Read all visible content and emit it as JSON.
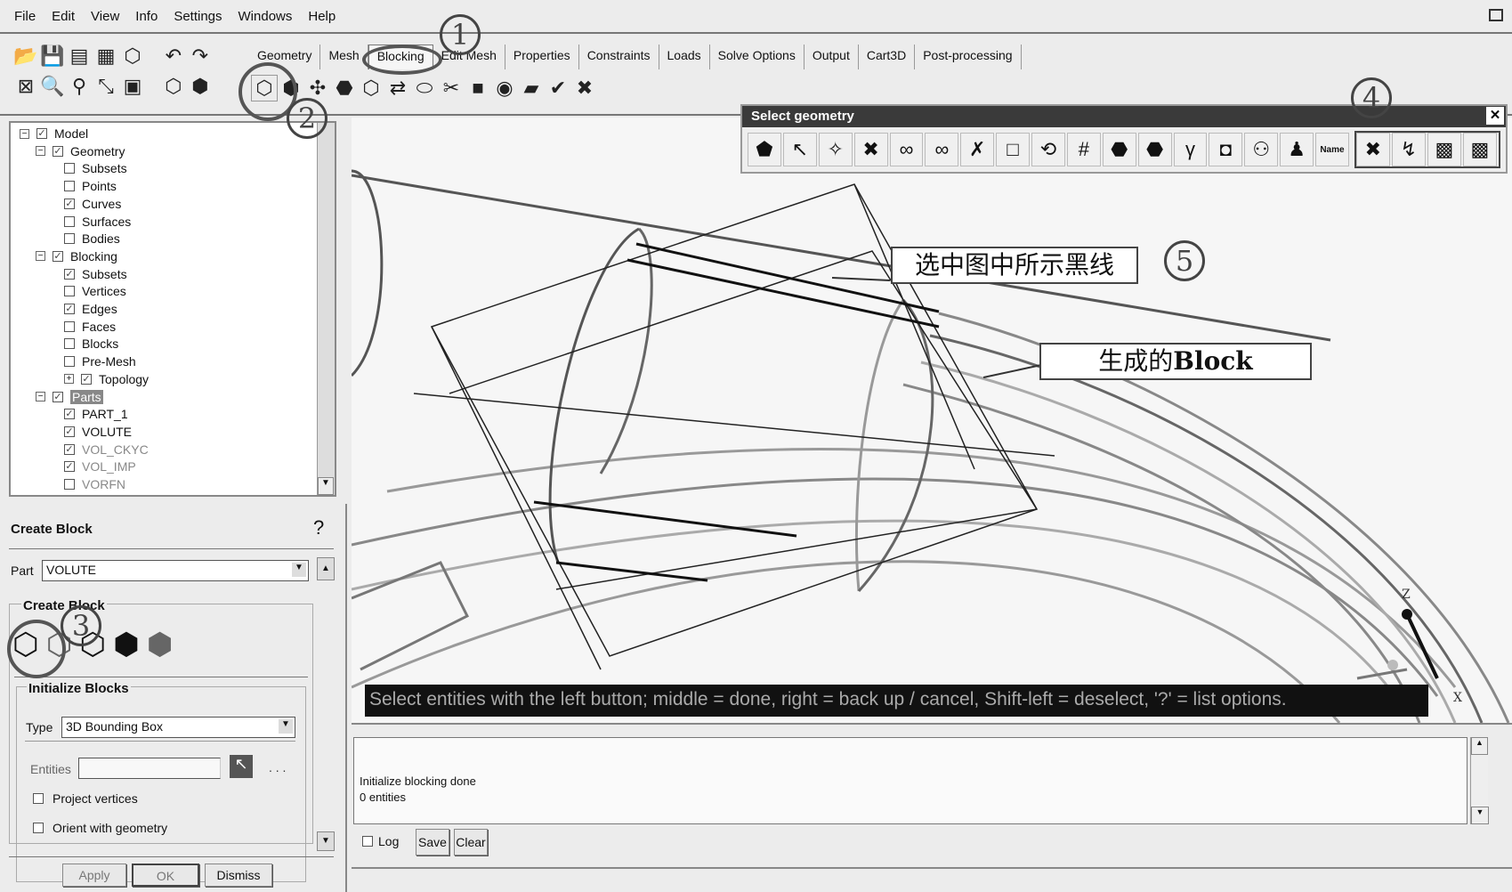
{
  "menu": [
    "File",
    "Edit",
    "View",
    "Info",
    "Settings",
    "Windows",
    "Help"
  ],
  "tabs": [
    "Geometry",
    "Mesh",
    "Blocking",
    "Edit Mesh",
    "Properties",
    "Constraints",
    "Loads",
    "Solve Options",
    "Output",
    "Cart3D",
    "Post-processing"
  ],
  "active_tab": "Blocking",
  "tree": [
    {
      "label": "Model",
      "level": 0,
      "checked": true,
      "exp": "-"
    },
    {
      "label": "Geometry",
      "level": 1,
      "checked": true,
      "exp": "-"
    },
    {
      "label": "Subsets",
      "level": 2,
      "checked": false
    },
    {
      "label": "Points",
      "level": 2,
      "checked": false
    },
    {
      "label": "Curves",
      "level": 2,
      "checked": true
    },
    {
      "label": "Surfaces",
      "level": 2,
      "checked": false
    },
    {
      "label": "Bodies",
      "level": 2,
      "checked": false
    },
    {
      "label": "Blocking",
      "level": 1,
      "checked": true,
      "exp": "-"
    },
    {
      "label": "Subsets",
      "level": 2,
      "checked": true
    },
    {
      "label": "Vertices",
      "level": 2,
      "checked": false
    },
    {
      "label": "Edges",
      "level": 2,
      "checked": true
    },
    {
      "label": "Faces",
      "level": 2,
      "checked": false
    },
    {
      "label": "Blocks",
      "level": 2,
      "checked": false
    },
    {
      "label": "Pre-Mesh",
      "level": 2,
      "checked": false
    },
    {
      "label": "Topology",
      "level": 2,
      "checked": true,
      "exp": "+"
    },
    {
      "label": "Parts",
      "level": 1,
      "checked": true,
      "exp": "-",
      "highlight": true
    },
    {
      "label": "PART_1",
      "level": 2,
      "checked": true
    },
    {
      "label": "VOLUTE",
      "level": 2,
      "checked": true
    },
    {
      "label": "VOL_CKYC",
      "level": 2,
      "checked": true,
      "dim": true
    },
    {
      "label": "VOL_IMP",
      "level": 2,
      "checked": true,
      "dim": true
    },
    {
      "label": "VORFN",
      "level": 2,
      "checked": false,
      "dim": true
    }
  ],
  "create_block": {
    "title": "Create Block",
    "part_label": "Part",
    "part_value": "VOLUTE",
    "group_label": "Create Block",
    "init_label": "Initialize Blocks",
    "type_label": "Type",
    "type_value": "3D Bounding Box",
    "entities_label": "Entities",
    "entities_value": "",
    "more": ". . .",
    "project_vertices": "Project vertices",
    "orient": "Orient with geometry",
    "apply": "Apply",
    "ok": "OK",
    "dismiss": "Dismiss"
  },
  "select_geometry": {
    "title": "Select geometry",
    "name_icon": "Name"
  },
  "status_prompt": "Select entities with the left button; middle = done, right = back up / cancel, Shift-left = deselect, '?' = list options.",
  "messages": [
    "Initialize blocking done",
    "0 entities"
  ],
  "log": {
    "log": "Log",
    "save": "Save",
    "clear": "Clear"
  },
  "annotations": {
    "n1": "1",
    "n2": "2",
    "n3": "3",
    "n4": "4",
    "n5": "5",
    "callout1": "选中图中所示黑线",
    "callout2_cn": "生成的",
    "callout2_en": "Block"
  },
  "axes": {
    "z": "Z",
    "x": "X"
  }
}
